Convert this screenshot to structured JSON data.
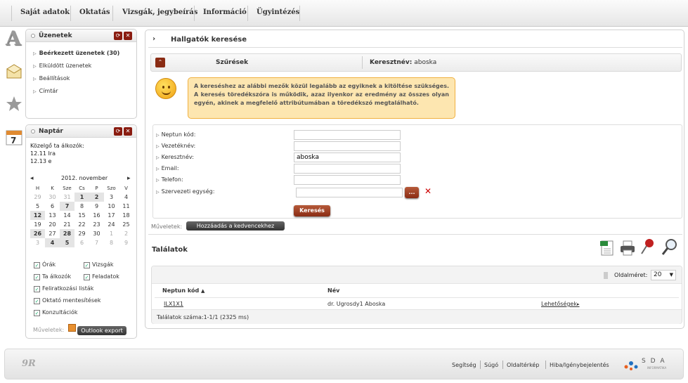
{
  "top_menu": [
    "Saját adatok",
    "Oktatás",
    "Vizsgák, jegybeírás",
    "Információ",
    "Ügyintézés"
  ],
  "messages": {
    "title": "Üzenetek",
    "items": [
      "Beérkezett üzenetek (30)",
      "Elküldött üzenetek",
      "Beállítások",
      "Címtár"
    ]
  },
  "calendar": {
    "title": "Naptár",
    "upcoming_label": "Közelgő ta álkozók:",
    "upcoming": [
      "12.11 Ira",
      "12.13 e"
    ],
    "month": "2012. november",
    "weekdays": [
      "H",
      "K",
      "Sze",
      "Cs",
      "P",
      "Szo",
      "V"
    ],
    "weeks": [
      [
        "29",
        "30",
        "31",
        "1",
        "2",
        "3",
        "4"
      ],
      [
        "5",
        "6",
        "7",
        "8",
        "9",
        "10",
        "11"
      ],
      [
        "12",
        "13",
        "14",
        "15",
        "16",
        "17",
        "18"
      ],
      [
        "19",
        "20",
        "21",
        "22",
        "23",
        "24",
        "25"
      ],
      [
        "26",
        "27",
        "28",
        "29",
        "30",
        "1",
        "2"
      ],
      [
        "3",
        "4",
        "5",
        "6",
        "7",
        "8",
        "9"
      ]
    ],
    "checkboxes": [
      "Órák",
      "Vizsgák",
      "Ta álkozók",
      "Feladatok",
      "Feliratkozási listák",
      "Oktató mentesítések",
      "Konzultációk"
    ],
    "actions_label": "Műveletek:",
    "outlook_export": "Outlook export"
  },
  "main": {
    "title": "Hallgatók keresése",
    "filters_label": "Szűrések",
    "filter_summary_key": "Keresztnév:",
    "filter_summary_value": "aboska",
    "hint": "A kereséshez az alábbi mezők közül legalább az egyiknek a kitöltése szükséges. A keresés töredékszóra is működik, azaz ilyenkor az eredmény az összes olyan egyén, akinek a megfelelő attribútumában a töredékszó megtalálható.",
    "fields": [
      {
        "label": "Neptun kód:",
        "value": ""
      },
      {
        "label": "Vezetéknév:",
        "value": ""
      },
      {
        "label": "Keresztnév:",
        "value": "aboska"
      },
      {
        "label": "Email:",
        "value": ""
      },
      {
        "label": "Telefon:",
        "value": ""
      },
      {
        "label": "Szervezeti egység:",
        "value": ""
      }
    ],
    "org_button": "...",
    "search_button": "Keresés",
    "actions_label": "Műveletek:",
    "add_favorite": "Hozzáadás a kedvencekhez",
    "results_title": "Találatok",
    "page_size_label": "Oldalméret:",
    "page_size": "20",
    "columns": [
      "Neptun kód",
      "Név"
    ],
    "rows": [
      {
        "code": "ILX1X1",
        "name": "dr. Ugrosdy1 Aboska",
        "action": "Lehetőségek"
      }
    ],
    "results_count": "Találatok száma:1-1/1 (2325 ms)"
  },
  "footer": {
    "links": [
      "Segítség",
      "Súgó",
      "Oldaltérkép",
      "Hiba/Igénybejelentés"
    ],
    "logo_left": "9R",
    "logo_right": "S D A",
    "logo_right_sub": "INFORMATIKA"
  },
  "colors": {
    "accent": "#8a2c14",
    "hint_bg": "#fde6b0",
    "hint_border": "#f0b040"
  }
}
